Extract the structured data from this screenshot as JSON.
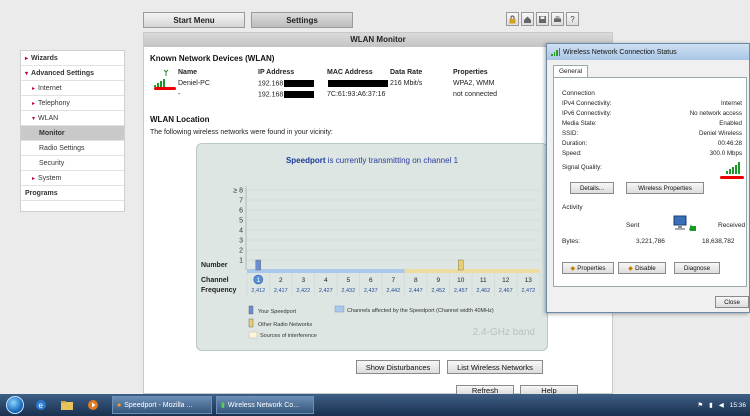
{
  "nav": {
    "start_menu": "Start Menu",
    "settings": "Settings"
  },
  "icons": [
    "lock-icon",
    "home-icon",
    "save-icon",
    "print-icon",
    "help-icon"
  ],
  "help_glyph": "?",
  "menu": {
    "wizards": "Wizards",
    "advanced": "Advanced Settings",
    "internet": "Internet",
    "telephony": "Telephony",
    "wlan": "WLAN",
    "monitor": "Monitor",
    "radio": "Radio Settings",
    "security": "Security",
    "system": "System",
    "programs": "Programs"
  },
  "panel": {
    "title": "WLAN Monitor",
    "known_title": "Known Network Devices (WLAN)",
    "headers": {
      "name": "Name",
      "ip": "IP Address",
      "mac": "MAC Address",
      "rate": "Data Rate",
      "props": "Properties"
    },
    "devices": [
      {
        "name": "Deniel-PC",
        "ip": "192.168",
        "mac": "",
        "rate": "216 Mbit/s",
        "props": "WPA2, WMM"
      },
      {
        "name": "-",
        "ip": "192.168",
        "mac": "7C:61:93:A6:37:16",
        "rate": "",
        "props": "not connected"
      }
    ],
    "location_title": "WLAN Location",
    "location_desc": "The following wireless networks were found in your vicinity:",
    "btn_disturbances": "Show Disturbances",
    "btn_list": "List Wireless Networks",
    "btn_refresh": "Refresh",
    "btn_help": "Help"
  },
  "chart_data": {
    "type": "bar",
    "message_name": "Speedport",
    "message_rest": " is currently transmitting on channel 1",
    "ylabel": "Number",
    "yticks": [
      "1",
      "2",
      "3",
      "4",
      "5",
      "6",
      "7",
      "≥ 8"
    ],
    "channel_label": "Channel",
    "frequency_label": "Frequency",
    "channels": [
      "1",
      "2",
      "3",
      "4",
      "5",
      "6",
      "7",
      "8",
      "9",
      "10",
      "11",
      "12",
      "13"
    ],
    "frequencies": [
      "2,412",
      "2,417",
      "2,422",
      "2,427",
      "2,432",
      "2,437",
      "2,442",
      "2,447",
      "2,452",
      "2,457",
      "2,462",
      "2,467",
      "2,472"
    ],
    "series": [
      {
        "name": "Your Speedport",
        "channel": 1,
        "count": 1,
        "color": "#6a8fd0"
      },
      {
        "name": "Other Radio Networks",
        "channel": 10,
        "count": 1,
        "color": "#e8cf70"
      }
    ],
    "affected_channels": [
      1,
      7
    ],
    "legend": {
      "your": "Your Speedport",
      "other": "Other Radio Networks",
      "interference": "Sources of interference",
      "affected": "Channels affected by the Speedport (Channel width 40MHz)"
    },
    "band": "2.4-GHz band"
  },
  "dialog": {
    "title": "Wireless Network Connection Status",
    "tab": "General",
    "connection_label": "Connection",
    "rows": [
      {
        "k": "IPv4 Connectivity:",
        "v": "Internet"
      },
      {
        "k": "IPv6 Connectivity:",
        "v": "No network access"
      },
      {
        "k": "Media State:",
        "v": "Enabled"
      },
      {
        "k": "SSID:",
        "v": "Deniel Wireless"
      },
      {
        "k": "Duration:",
        "v": "00:46:28"
      },
      {
        "k": "Speed:",
        "v": "300.0 Mbps"
      }
    ],
    "signal_label": "Signal Quality:",
    "details": "Details...",
    "wireless_props": "Wireless Properties",
    "activity_label": "Activity",
    "sent": "Sent",
    "received": "Received",
    "bytes_label": "Bytes:",
    "bytes_sent": "3,221,786",
    "bytes_received": "18,638,782",
    "properties": "Properties",
    "disable": "Disable",
    "diagnose": "Diagnose",
    "close": "Close"
  },
  "taskbar": {
    "task1": "Speedport - Mozilla ...",
    "task2": "Wireless Network Co...",
    "time": "15:36"
  }
}
